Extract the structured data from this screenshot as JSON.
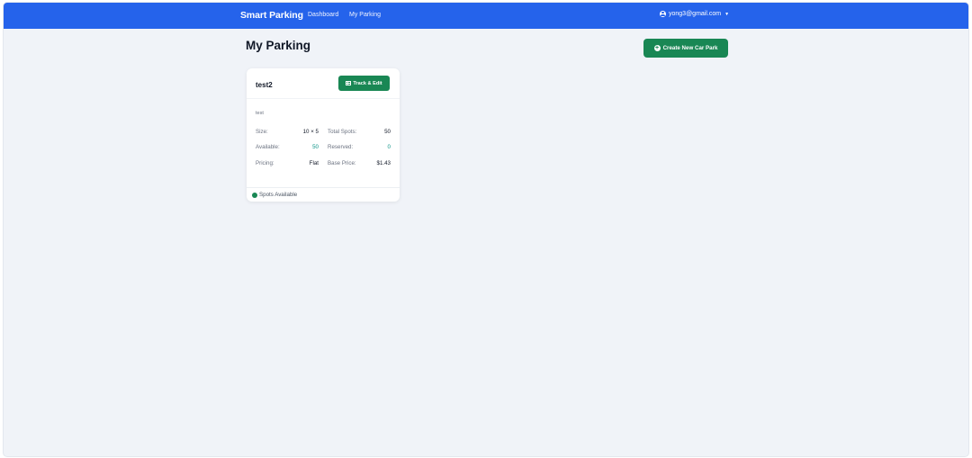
{
  "navbar": {
    "brand": "Smart Parking",
    "links": [
      "Dashboard",
      "My Parking"
    ],
    "user_email": "yong3@gmail.com",
    "color": "#2563eb"
  },
  "page": {
    "title": "My Parking",
    "create_button": "Create New Car Park"
  },
  "car_parks": [
    {
      "name": "test2",
      "action_button": "Track & Edit",
      "description": "test",
      "stats": {
        "size_label": "Size:",
        "size": "10 × 5",
        "total_label": "Total Spots:",
        "total": "50",
        "available_label": "Available:",
        "available": "50",
        "reserved_label": "Reserved:",
        "reserved": "0",
        "pricing_label": "Pricing:",
        "pricing": "Flat",
        "base_price_label": "Base Price:",
        "base_price": "$1.43"
      },
      "status": "Spots Available",
      "status_color": "#198754"
    }
  ]
}
